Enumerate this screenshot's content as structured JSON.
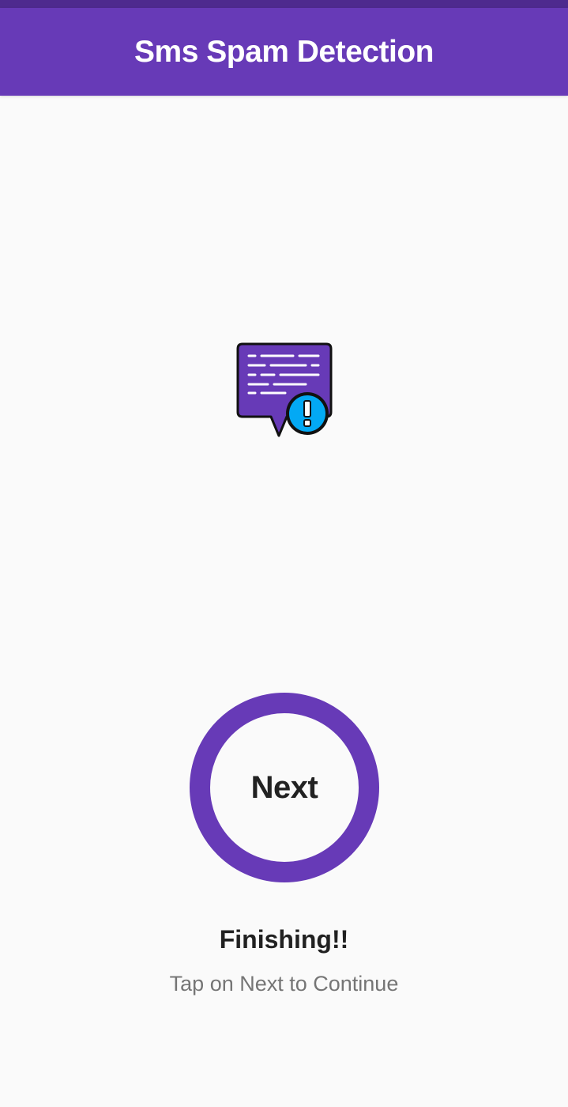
{
  "app_bar": {
    "title": "Sms Spam Detection",
    "color": "#673ab7"
  },
  "logo": {
    "icon": "spam-message-icon"
  },
  "next_button": {
    "label": "Next",
    "ring_color": "#673ab7"
  },
  "footer": {
    "title": "Finishing!!",
    "subtitle": "Tap on Next to Continue"
  }
}
